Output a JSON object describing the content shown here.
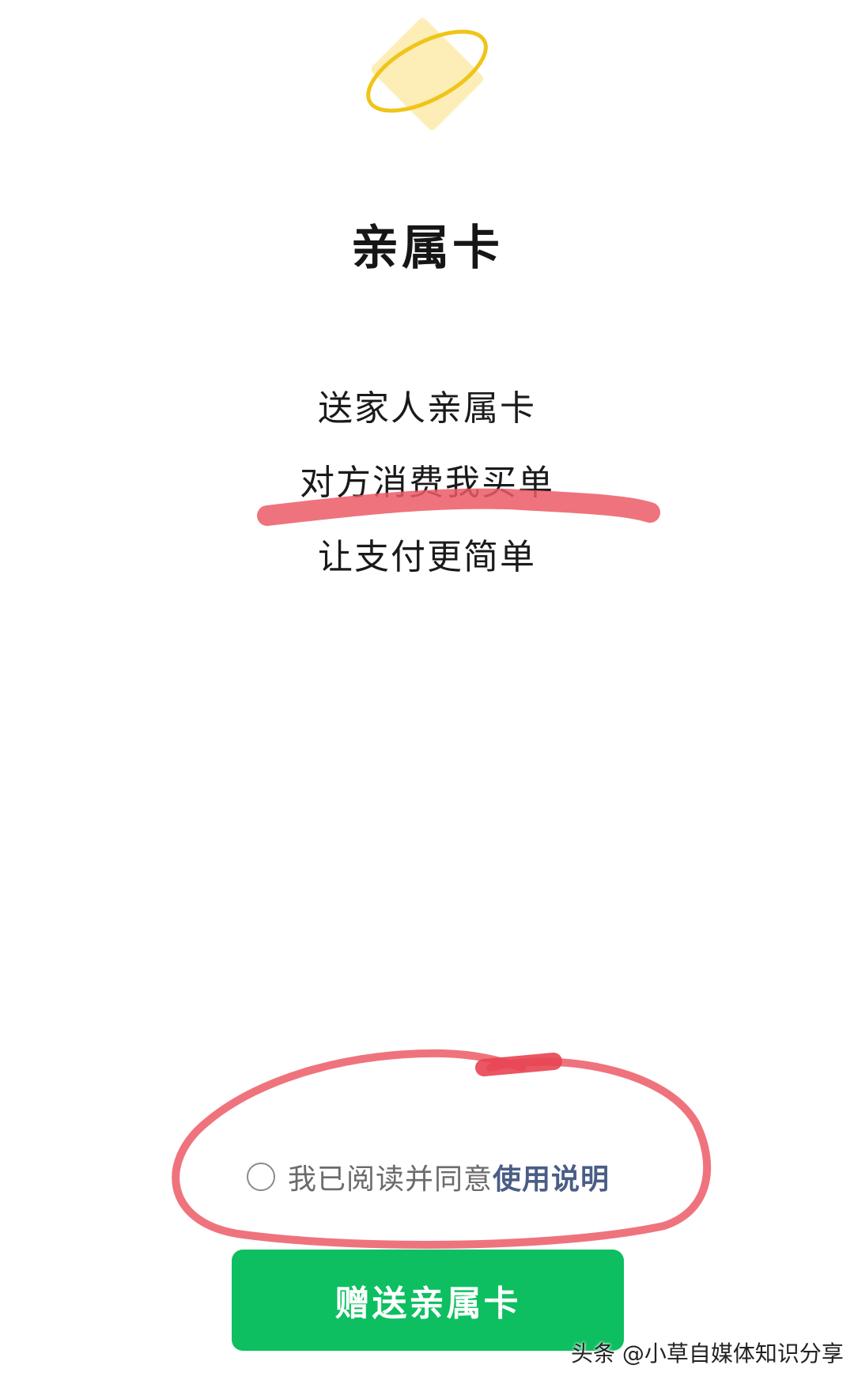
{
  "header": {
    "title": "亲属卡"
  },
  "intro": {
    "line1": "送家人亲属卡",
    "line2": "对方消费我买单",
    "line3": "让支付更简单"
  },
  "agreement": {
    "text": "我已阅读并同意",
    "link": "使用说明",
    "checked": false
  },
  "actions": {
    "gift_label": "赠送亲属卡"
  },
  "watermark": "头条 @小草自媒体知识分享",
  "colors": {
    "primary_button": "#0dbf60",
    "link": "#4a5d86",
    "logo_card": "#fdedb7",
    "logo_ring": "#f0c419",
    "annotation_marker": "#ec5a66"
  },
  "icons": {
    "logo": "card-with-orbit-ring-icon",
    "checkbox": "radio-circle-icon"
  }
}
